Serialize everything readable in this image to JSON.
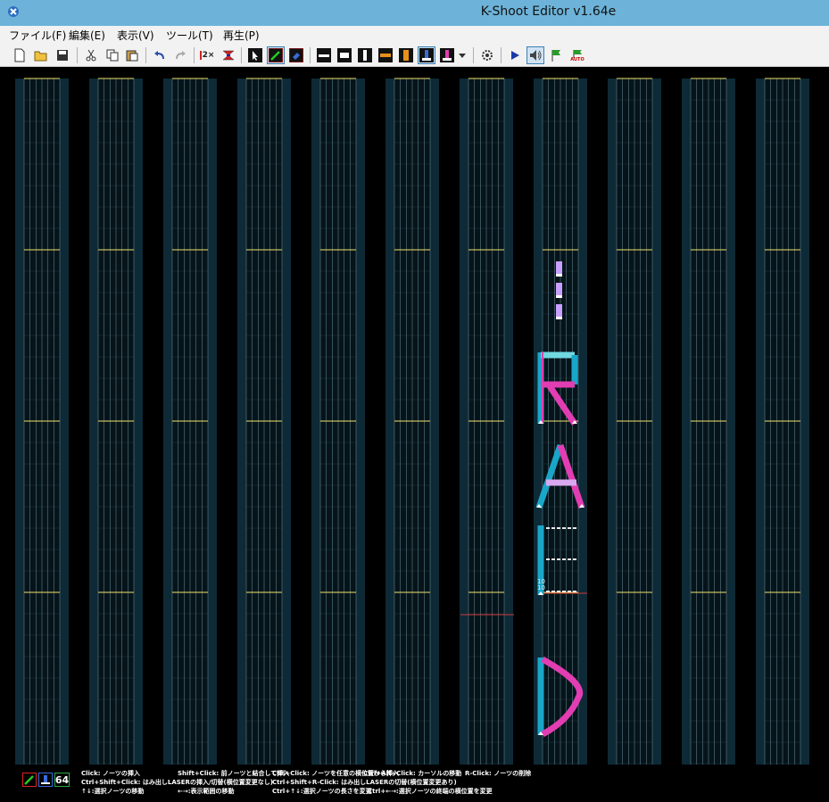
{
  "window": {
    "title": "K-Shoot Editor v1.64e"
  },
  "menu": [
    "ファイル(F)",
    "編集(E)",
    "表示(V)",
    "ツール(T)",
    "再生(P)"
  ],
  "toolbar": {
    "icons": [
      "new-file-icon",
      "open-folder-icon",
      "save-icon",
      "cut-icon",
      "copy-icon",
      "paste-icon",
      "undo-icon",
      "redo-icon",
      "double-speed-icon",
      "spectrum-icon",
      "select-cursor-icon",
      "laser-pen-icon",
      "eraser-icon",
      "bt-a-icon",
      "bt-b-icon",
      "bt-c-icon",
      "fx-l-icon",
      "fx-r-icon",
      "bt-long-icon",
      "chip-icon",
      "dropdown-arrow-icon",
      "settings-gear-icon",
      "play-icon",
      "sound-icon",
      "autoplay-flag-icon",
      "auto-icon"
    ],
    "double_label": "2×",
    "auto_label": "AUTO"
  },
  "editor": {
    "measures_count": 11,
    "lyric_letters": [
      "R",
      "A",
      "E",
      "D"
    ],
    "small_numbers": [
      "10",
      "10"
    ],
    "colors": {
      "lane_bg": "#0e2a36",
      "grid": "#7fa9b8",
      "bar_line": "#f2e36a",
      "laser_left": "#1aa6c9",
      "laser_right": "#e23db2",
      "cursor": "#d23a3a"
    }
  },
  "status": {
    "bpm_value": "64",
    "help_lines": [
      "Click: ノーツの挿入",
      "Ctrl+Shift+Click: はみ出しLASERの挿入/切替(横位置変更なし)",
      "↑↓:選択ノーツの移動",
      "Shift+Click: 前ノーツと結合して挿入",
      "←→:表示範囲の移動",
      "Ctrl+Click: ノーツを任意の横位置から挿入",
      "Ctrl+Shift+R-Click: はみ出しLASERの切替(横位置変更あり)",
      "Ctrl+↑↓:選択ノーツの長さを変更",
      "Ctrl+Alt+Click: カーソルの移動",
      "Ctrl+←→:選択ノーツの終端の横位置を変更",
      "R-Click: ノーツの削除"
    ]
  }
}
